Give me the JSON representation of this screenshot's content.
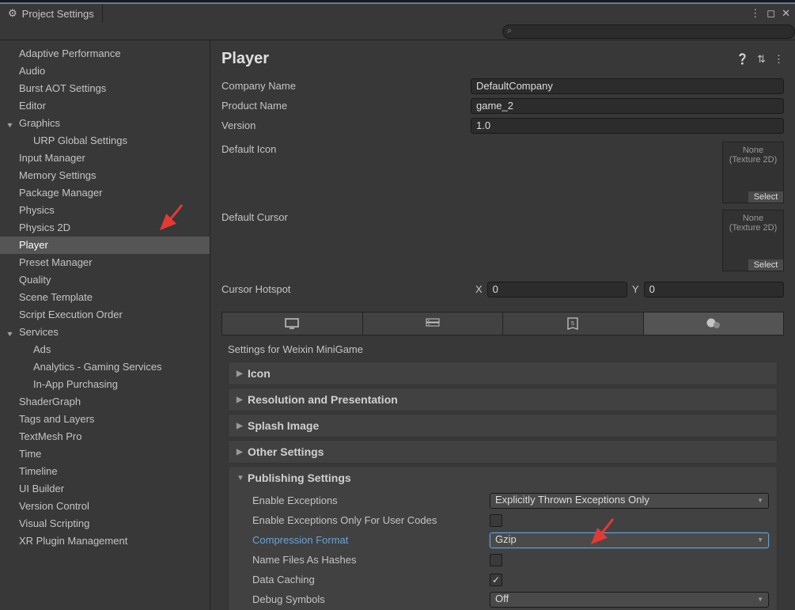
{
  "window": {
    "title": "Project Settings"
  },
  "search": {
    "placeholder": ""
  },
  "sidebar": {
    "items": [
      {
        "label": "Adaptive Performance",
        "indent": 0
      },
      {
        "label": "Audio",
        "indent": 0
      },
      {
        "label": "Burst AOT Settings",
        "indent": 0
      },
      {
        "label": "Editor",
        "indent": 0
      },
      {
        "label": "Graphics",
        "indent": 0,
        "expandable": true
      },
      {
        "label": "URP Global Settings",
        "indent": 1
      },
      {
        "label": "Input Manager",
        "indent": 0
      },
      {
        "label": "Memory Settings",
        "indent": 0
      },
      {
        "label": "Package Manager",
        "indent": 0
      },
      {
        "label": "Physics",
        "indent": 0
      },
      {
        "label": "Physics 2D",
        "indent": 0
      },
      {
        "label": "Player",
        "indent": 0,
        "selected": true
      },
      {
        "label": "Preset Manager",
        "indent": 0
      },
      {
        "label": "Quality",
        "indent": 0
      },
      {
        "label": "Scene Template",
        "indent": 0
      },
      {
        "label": "Script Execution Order",
        "indent": 0
      },
      {
        "label": "Services",
        "indent": 0,
        "expandable": true
      },
      {
        "label": "Ads",
        "indent": 1
      },
      {
        "label": "Analytics - Gaming Services",
        "indent": 1
      },
      {
        "label": "In-App Purchasing",
        "indent": 1
      },
      {
        "label": "ShaderGraph",
        "indent": 0
      },
      {
        "label": "Tags and Layers",
        "indent": 0
      },
      {
        "label": "TextMesh Pro",
        "indent": 0
      },
      {
        "label": "Time",
        "indent": 0
      },
      {
        "label": "Timeline",
        "indent": 0
      },
      {
        "label": "UI Builder",
        "indent": 0
      },
      {
        "label": "Version Control",
        "indent": 0
      },
      {
        "label": "Visual Scripting",
        "indent": 0
      },
      {
        "label": "XR Plugin Management",
        "indent": 0
      }
    ]
  },
  "main": {
    "title": "Player",
    "fields": {
      "company_label": "Company Name",
      "company_value": "DefaultCompany",
      "product_label": "Product Name",
      "product_value": "game_2",
      "version_label": "Version",
      "version_value": "1.0",
      "default_icon_label": "Default Icon",
      "default_cursor_label": "Default Cursor",
      "asset_none": "None",
      "asset_type": "(Texture 2D)",
      "asset_select": "Select",
      "cursor_hotspot_label": "Cursor Hotspot",
      "hotspot_x_label": "X",
      "hotspot_x": "0",
      "hotspot_y_label": "Y",
      "hotspot_y": "0"
    },
    "platform_section_label": "Settings for Weixin MiniGame",
    "foldouts": {
      "icon": "Icon",
      "resolution": "Resolution and Presentation",
      "splash": "Splash Image",
      "other": "Other Settings",
      "publishing": "Publishing Settings"
    },
    "publishing": {
      "enable_exceptions_label": "Enable Exceptions",
      "enable_exceptions_value": "Explicitly Thrown Exceptions Only",
      "user_codes_label": "Enable Exceptions Only For User Codes",
      "user_codes_value": false,
      "compression_label": "Compression Format",
      "compression_value": "Gzip",
      "name_hashes_label": "Name Files As Hashes",
      "name_hashes_value": false,
      "data_caching_label": "Data Caching",
      "data_caching_value": true,
      "debug_symbols_label": "Debug Symbols",
      "debug_symbols_value": "Off"
    }
  }
}
